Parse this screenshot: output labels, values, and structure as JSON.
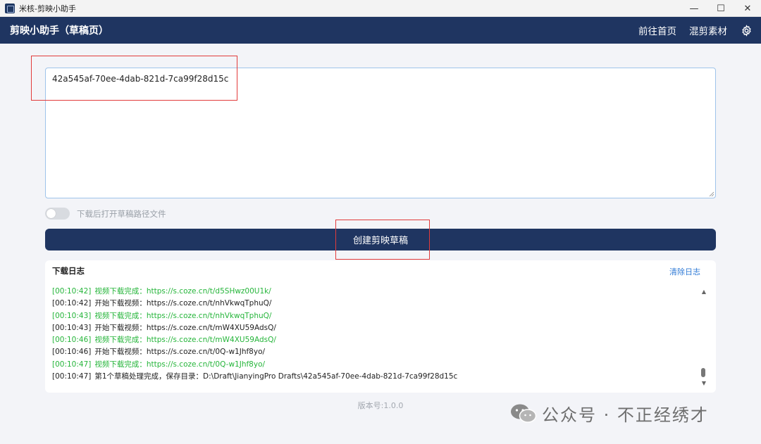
{
  "window": {
    "title": "米核-剪映小助手",
    "minimize": "—",
    "maximize": "☐",
    "close": "✕"
  },
  "header": {
    "title": "剪映小助手（草稿页）",
    "nav": [
      "前往首页",
      "混剪素材"
    ],
    "settings_icon": "gear-icon"
  },
  "draft": {
    "value": "42a545af-70ee-4dab-821d-7ca99f28d15c"
  },
  "toggle": {
    "label": "下载后打开草稿路径文件",
    "on": false
  },
  "create_button": "创建剪映草稿",
  "log": {
    "title": "下载日志",
    "clear": "清除日志",
    "lines": [
      {
        "time": "[00:10:42]",
        "text": "视频下载完成：https://s.coze.cn/t/d5SHwz00U1k/",
        "color": "green"
      },
      {
        "time": "[00:10:42]",
        "text": "开始下载视频：https://s.coze.cn/t/nhVkwqTphuQ/",
        "color": "dark"
      },
      {
        "time": "[00:10:43]",
        "text": "视频下载完成：https://s.coze.cn/t/nhVkwqTphuQ/",
        "color": "green"
      },
      {
        "time": "[00:10:43]",
        "text": "开始下载视频：https://s.coze.cn/t/mW4XU59AdsQ/",
        "color": "dark"
      },
      {
        "time": "[00:10:46]",
        "text": "视频下载完成：https://s.coze.cn/t/mW4XU59AdsQ/",
        "color": "green"
      },
      {
        "time": "[00:10:46]",
        "text": "开始下载视频：https://s.coze.cn/t/0Q-w1Jhf8yo/",
        "color": "dark"
      },
      {
        "time": "[00:10:47]",
        "text": "视频下载完成：https://s.coze.cn/t/0Q-w1Jhf8yo/",
        "color": "green"
      },
      {
        "time": "[00:10:47]",
        "text": "第1个草稿处理完成，保存目录：D:\\Draft\\JianyingPro Drafts\\42a545af-70ee-4dab-821d-7ca99f28d15c",
        "color": "dark"
      }
    ]
  },
  "version": "版本号:1.0.0",
  "watermark": "公众号 · 不正经绣才",
  "colors": {
    "brand": "#1f3561",
    "success": "#25b53a",
    "link": "#2f7ad6",
    "highlight": "#e23b3b"
  }
}
